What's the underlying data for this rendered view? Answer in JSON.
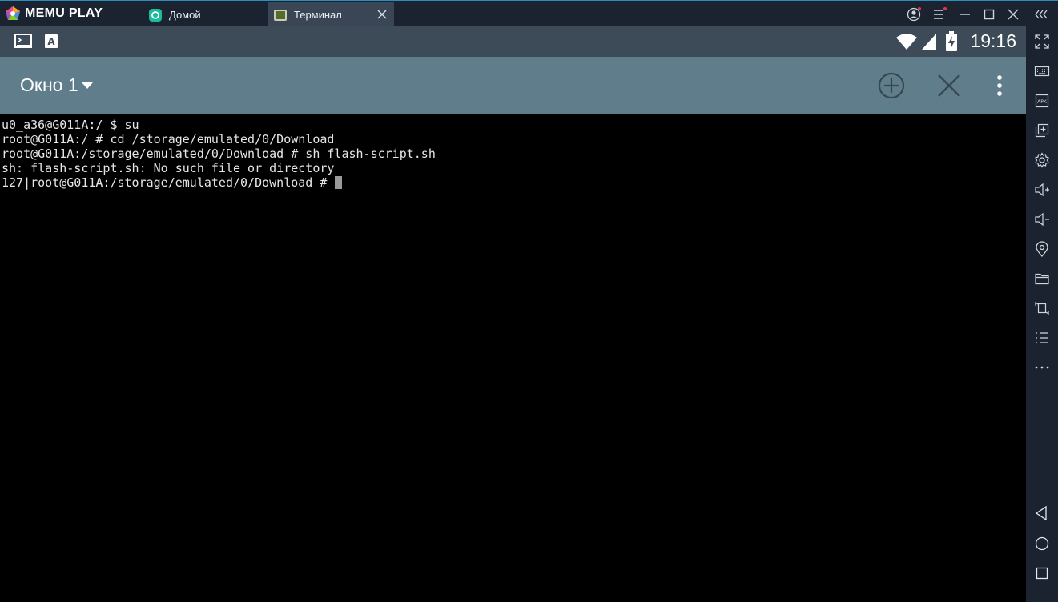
{
  "app": {
    "logo_text": "MEMU PLAY"
  },
  "tabs": [
    {
      "label": "Домой",
      "icon": "home-app-icon",
      "active": false
    },
    {
      "label": "Терминал",
      "icon": "terminal-app-icon",
      "active": true
    }
  ],
  "status": {
    "time": "19:16"
  },
  "appbar": {
    "title": "Окно 1"
  },
  "terminal": {
    "lines": [
      "u0_a36@G011A:/ $ su",
      "root@G011A:/ # cd /storage/emulated/0/Download",
      "root@G011A:/storage/emulated/0/Download # sh flash-script.sh",
      "sh: flash-script.sh: No such file or directory",
      "127|root@G011A:/storage/emulated/0/Download # "
    ]
  },
  "colors": {
    "titlebar": "#1b2330",
    "statusbar": "#3d4a57",
    "appbar": "#607d8b",
    "terminal_bg": "#000000",
    "terminal_fg": "#e6e6e6"
  }
}
